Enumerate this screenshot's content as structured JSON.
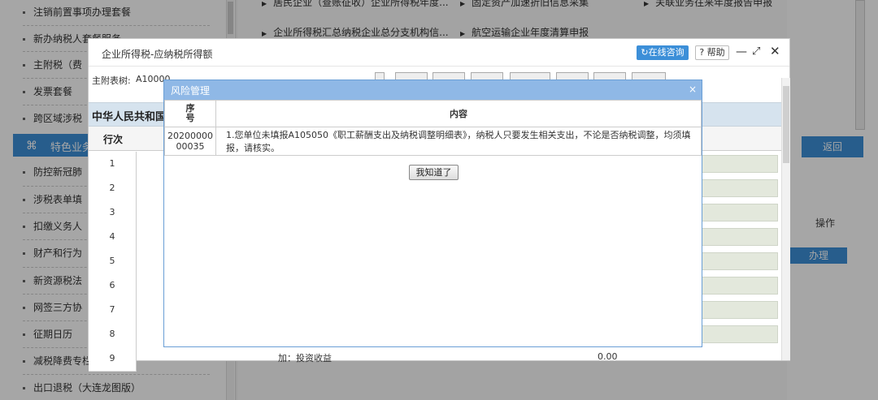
{
  "sidebar": {
    "items": [
      {
        "label": "注销前置事项办理套餐"
      },
      {
        "label": "新办纳税人套餐服务"
      },
      {
        "label": "主附税（费"
      },
      {
        "label": "发票套餐"
      },
      {
        "label": "跨区域涉税"
      },
      {
        "label": "防控新冠肺"
      },
      {
        "label": "涉税表单填"
      },
      {
        "label": "扣缴义务人"
      },
      {
        "label": "财产和行为"
      },
      {
        "label": "新资源税法"
      },
      {
        "label": "网签三方协"
      },
      {
        "label": "征期日历"
      },
      {
        "label": "减税降费专栏"
      },
      {
        "label": "出口退税（大连龙图版）"
      }
    ],
    "active": {
      "label": "特色业务"
    }
  },
  "main": {
    "nav": [
      {
        "label": "居民企业（查账征收）企业所得税年度..."
      },
      {
        "label": "固定资产加速折旧信息采集"
      },
      {
        "label": "关联业务往来年度报告申报"
      },
      {
        "label": "企业所得税汇总纳税企业总分支机构信..."
      },
      {
        "label": "航空运输企业年度清算申报"
      }
    ],
    "return_label": "返回",
    "operation_label": "操作",
    "handle_label": "办理"
  },
  "outer_dialog": {
    "title": "企业所得税-应纳税所得额",
    "consult_label": "在线咨询",
    "help_label": "帮助",
    "attach_label": "主附表树:",
    "attach_value": "A10000",
    "table_title": "中华人民共和国企",
    "col_header": "行次",
    "rows": [
      "1",
      "2",
      "3",
      "4",
      "5",
      "6",
      "7",
      "8",
      "9"
    ],
    "last_row_label": "加：投资收益",
    "last_row_value": "0.00"
  },
  "risk_dialog": {
    "title": "风险管理",
    "headers": {
      "seq": "序号",
      "content": "内容"
    },
    "rows": [
      {
        "seq": "2020000000035",
        "content": "1.您单位未填报A105050《职工薪酬支出及纳税调整明细表》，纳税人只要发生相关支出，不论是否纳税调整，均须填报，请核实。"
      }
    ],
    "ack_label": "我知道了"
  }
}
